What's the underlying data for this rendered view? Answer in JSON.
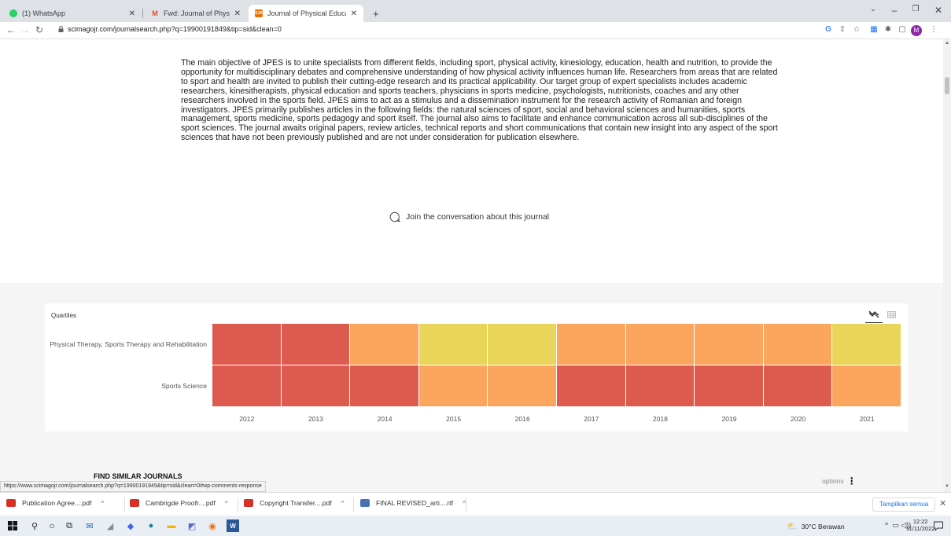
{
  "tabs": [
    {
      "label": "(1) WhatsApp",
      "favicon_color": "#25d366"
    },
    {
      "label": "Fwd: Journal of Physical Educatio",
      "favicon_color": "#ea4335"
    },
    {
      "label": "Journal of Physical Education and",
      "favicon_color": "#e8710a",
      "favicon_text": "SJR"
    }
  ],
  "address": {
    "url": "scimagojr.com/journalsearch.php?q=19900191849&tip=sid&clean=0",
    "profile_initial": "M"
  },
  "page": {
    "description": "The main objective of JPES is to unite specialists from different fields, including sport, physical activity, kinesiology, education, health and nutrition, to provide the opportunity for multidisciplinary debates and comprehensive understanding of how physical activity influences human life. Researchers from areas that are related to sport and health are invited to publish their cutting-edge research and its practical applicability. Our target group of expert specialists includes academic researchers, kinesitherapists, physical education and sports teachers, physicians in sports medicine, psychologists, nutritionists, coaches and any other researchers involved in the sports field. JPES aims to act as a stimulus and a dissemination instrument for the research activity of Romanian and foreign investigators. JPES primarily publishes articles in the following fields: the natural sciences of sport, social and behavioral sciences and humanities, sports management, sports medicine, sports pedagogy and sport itself. The journal also aims to facilitate and enhance communication across all sub-disciplines of the sport sciences. The journal awaits original papers, review articles, technical reports and short communications that contain new insight into any aspect of the sport sciences that have not been previously published and are not under consideration for publication elsewhere.",
    "join_label": "Join the conversation about this journal",
    "similar_label": "FIND SIMILAR JOURNALS",
    "options_label": "options",
    "status_url": "https://www.scimagojr.com/journalsearch.php?q=19900191849&tip=sid&clean=0#wp-comments-response"
  },
  "chart_data": {
    "type": "heatmap",
    "title": "Quartiles",
    "x": [
      "2012",
      "2013",
      "2014",
      "2015",
      "2016",
      "2017",
      "2018",
      "2019",
      "2020",
      "2021"
    ],
    "rows": [
      {
        "name": "Physical Therapy, Sports Therapy and Rehabilitation",
        "values": [
          "Q4",
          "Q4",
          "Q3",
          "Q2",
          "Q2",
          "Q3",
          "Q3",
          "Q3",
          "Q3",
          "Q2"
        ]
      },
      {
        "name": "Sports Science",
        "values": [
          "Q4",
          "Q4",
          "Q4",
          "Q3",
          "Q3",
          "Q4",
          "Q4",
          "Q4",
          "Q4",
          "Q3"
        ]
      }
    ],
    "colors": {
      "Q1": "#a4cf63",
      "Q2": "#e8d559",
      "Q3": "#fba55f",
      "Q4": "#dd5a4e"
    }
  },
  "downloads": [
    {
      "name": "Publication Agree....pdf",
      "color": "#d93025"
    },
    {
      "name": "Cambrigde Proofr....pdf",
      "color": "#d93025"
    },
    {
      "name": "Copyright Transfer....pdf",
      "color": "#d93025"
    },
    {
      "name": "FINAL REVISED_arti....rtf",
      "color": "#4a6fb5"
    }
  ],
  "downloads_show_all": "Tampilkan semua",
  "taskbar": {
    "weather": "30°C Berawan",
    "time": "12:22",
    "date": "11/11/2022"
  }
}
